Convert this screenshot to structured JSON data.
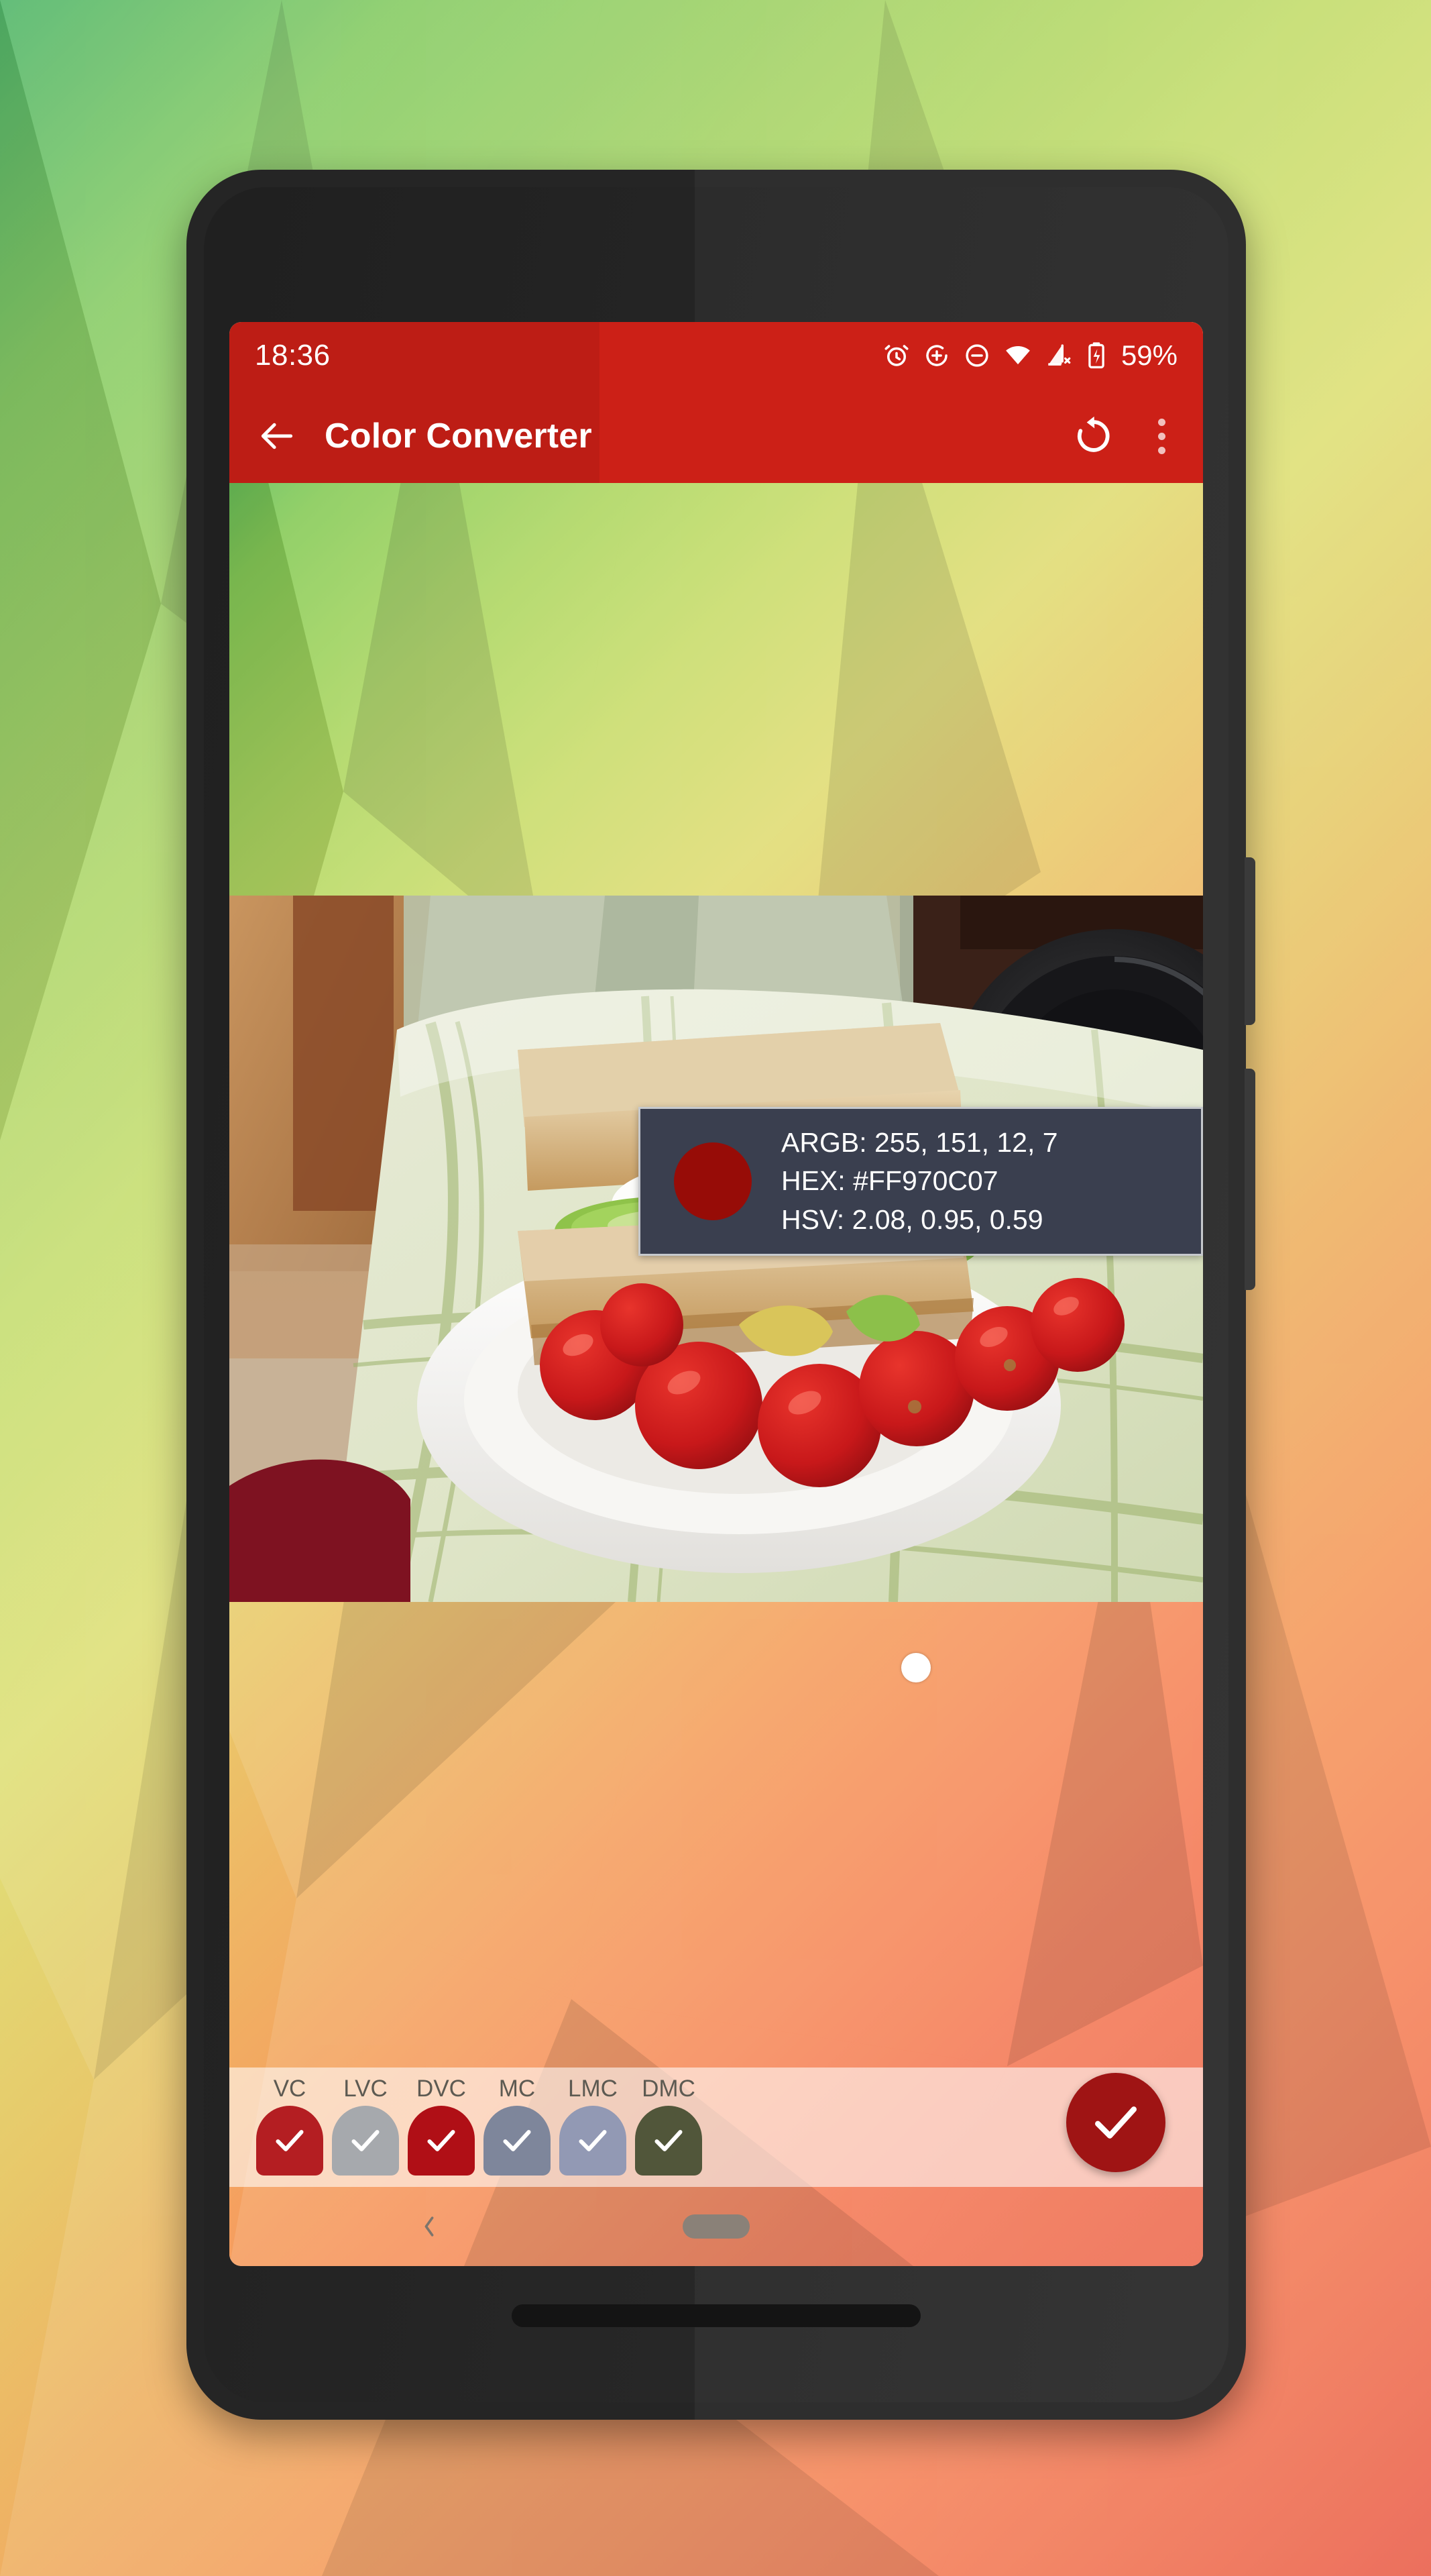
{
  "wallpaper": {
    "name": "low-poly-gradient",
    "from": "#3fae5a",
    "to": "#e95f4b"
  },
  "device": {
    "frame_color": "#2e2e2e",
    "earpiece": "earpiece-speaker",
    "front_camera": "front-camera",
    "power_button": "power-button",
    "volume_button": "volume-button",
    "bottom_speaker": "bottom-speaker"
  },
  "statusbar": {
    "time": "18:36",
    "battery_percent": "59%",
    "icons": [
      "alarm-icon",
      "sync-disabled-icon",
      "do-not-disturb-icon",
      "wifi-icon",
      "cellular-off-icon",
      "battery-charging-icon"
    ],
    "background": "#cc2017"
  },
  "appbar": {
    "back_icon": "arrow-back-icon",
    "title": "Color Converter",
    "reset_icon": "rotate-left-icon",
    "overflow_icon": "more-vert-icon",
    "background": "#cc2017"
  },
  "photo": {
    "name": "sandwich-with-tomatoes-photo",
    "description": "Sandwich with cucumber and egg on a white plate surrounded by cherry tomatoes, on a green checkered tablecloth"
  },
  "picker": {
    "marker": "color-picker-marker",
    "marker_color": "#ffffff"
  },
  "color_info": {
    "swatch_color": "#970c07",
    "argb_label": "ARGB: 255, 151, 12, 7",
    "hex_label": "HEX: #FF970C07",
    "hsv_label": "HSV: 2.08, 0.95, 0.59"
  },
  "palette": {
    "swatches": [
      {
        "label": "VC",
        "color": "#b41e22",
        "checked": true
      },
      {
        "label": "LVC",
        "color": "#a6a9ad",
        "checked": true
      },
      {
        "label": "DVC",
        "color": "#b00f16",
        "checked": true
      },
      {
        "label": "MC",
        "color": "#7e869b",
        "checked": true
      },
      {
        "label": "LMC",
        "color": "#9299b4",
        "checked": true
      },
      {
        "label": "DMC",
        "color": "#51563a",
        "checked": true
      }
    ],
    "confirm": {
      "name": "confirm-fab",
      "icon": "check-icon",
      "color": "#9f1414"
    }
  },
  "navbar": {
    "back_icon": "nav-back-icon",
    "home_pill": "nav-home-pill"
  }
}
